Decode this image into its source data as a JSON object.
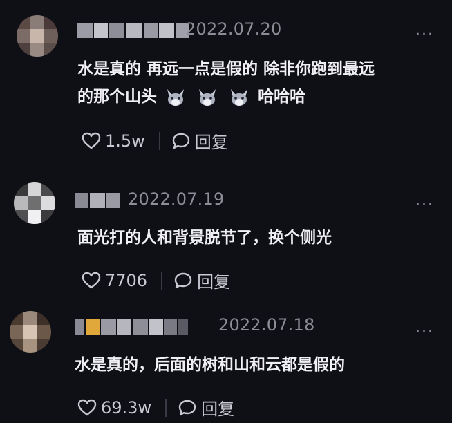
{
  "comments": [
    {
      "date": "2022.07.20",
      "text_line1": "水是真的 再远一点是假的 除非你跑到最远",
      "text_line2_a": "的那个山头",
      "text_line2_b": "哈哈哈",
      "likes": "1.5w",
      "reply_label": "回复",
      "more": "···"
    },
    {
      "date": "2022.07.19",
      "text_line1": "面光打的人和背景脱节了，换个侧光",
      "likes": "7706",
      "reply_label": "回复",
      "more": "···"
    },
    {
      "date": "2022.07.18",
      "text_line1": "水是真的，后面的树和山和云都是假的",
      "likes": "69.3w",
      "reply_label": "回复",
      "more": "···"
    }
  ],
  "icons": {
    "like": "heart-outline-icon",
    "reply": "speech-bubble-icon",
    "emoji": "wolf-emoji-icon",
    "more": "more-dots-icon"
  }
}
